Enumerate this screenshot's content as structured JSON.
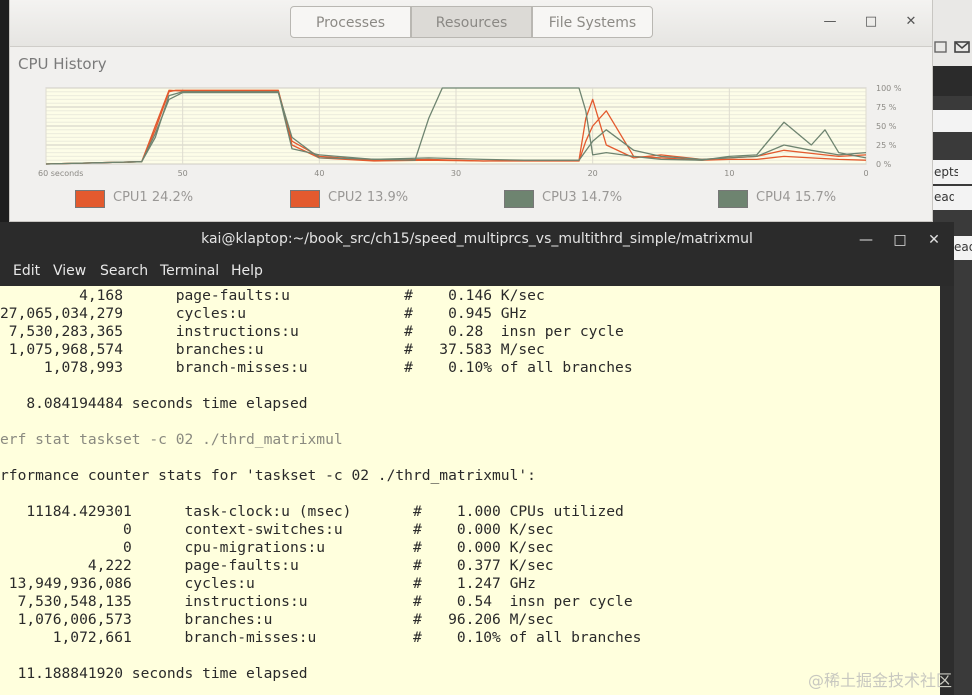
{
  "sysmon": {
    "tabs": [
      "Processes",
      "Resources",
      "File Systems"
    ],
    "active_tab": 1,
    "controls": {
      "minimize": "—",
      "maximize": "□",
      "close": "✕"
    },
    "cpu_history_title": "CPU History",
    "legend": [
      {
        "label": "CPU1  24.2%",
        "color": "#e35a2e"
      },
      {
        "label": "CPU2  13.9%",
        "color": "#e35a2e"
      },
      {
        "label": "CPU3  14.7%",
        "color": "#6e8470"
      },
      {
        "label": "CPU4  15.7%",
        "color": "#6e8470"
      }
    ]
  },
  "background_app": {
    "snippets": [
      "epts",
      "ead",
      "ead"
    ]
  },
  "chart_data": {
    "type": "line",
    "x_tick_labels": [
      "60 seconds",
      "50",
      "40",
      "30",
      "20",
      "10",
      "0"
    ],
    "y_tick_labels": [
      "100 %",
      "75 %",
      "50 %",
      "25 %",
      "0 %"
    ],
    "xlim": [
      60,
      0
    ],
    "ylim": [
      0,
      100
    ],
    "grid": true,
    "series": [
      {
        "name": "CPU1",
        "color": "#e35a2e",
        "x": [
          60,
          53,
          52,
          51,
          50.5,
          45,
          43,
          42,
          40,
          36,
          32,
          28,
          25,
          21,
          20.5,
          20,
          19,
          17,
          15,
          12,
          10,
          8,
          6,
          4,
          2,
          0
        ],
        "y": [
          0,
          3,
          45,
          95,
          97,
          97,
          97,
          30,
          10,
          5,
          6,
          4,
          5,
          5,
          60,
          85,
          25,
          8,
          12,
          6,
          8,
          10,
          18,
          14,
          10,
          12
        ]
      },
      {
        "name": "CPU2",
        "color": "#e35a2e",
        "x": [
          60,
          53,
          52,
          51,
          50,
          45,
          43,
          42,
          40,
          36,
          32,
          28,
          25,
          21,
          20.5,
          20,
          19,
          17,
          15,
          12,
          10,
          8,
          6,
          4,
          2,
          0
        ],
        "y": [
          0,
          3,
          50,
          97,
          96,
          96,
          96,
          25,
          8,
          4,
          5,
          4,
          4,
          4,
          30,
          50,
          70,
          10,
          8,
          5,
          6,
          6,
          10,
          8,
          6,
          5
        ]
      },
      {
        "name": "CPU3",
        "color": "#6e8470",
        "x": [
          60,
          53,
          52,
          51,
          50,
          45,
          43,
          42,
          40,
          33,
          32,
          31,
          28,
          25,
          21,
          20.5,
          20,
          19,
          17,
          15,
          12,
          10,
          8,
          6,
          4,
          3,
          2,
          0
        ],
        "y": [
          0,
          3,
          40,
          85,
          94,
          94,
          94,
          35,
          8,
          5,
          60,
          100,
          100,
          100,
          100,
          70,
          12,
          15,
          10,
          6,
          5,
          10,
          12,
          55,
          25,
          45,
          15,
          8
        ]
      },
      {
        "name": "CPU4",
        "color": "#6e8470",
        "x": [
          60,
          53,
          52,
          51,
          50,
          45,
          43,
          42,
          40,
          36,
          32,
          28,
          25,
          21,
          20,
          19,
          17,
          15,
          12,
          10,
          8,
          6,
          4,
          2,
          0
        ],
        "y": [
          0,
          3,
          35,
          90,
          95,
          95,
          95,
          20,
          12,
          6,
          8,
          6,
          5,
          5,
          30,
          45,
          18,
          10,
          6,
          8,
          10,
          25,
          18,
          12,
          15
        ]
      }
    ]
  },
  "terminal": {
    "title": "kai@klaptop:~/book_src/ch15/speed_multiprcs_vs_multithrd_simple/matrixmul",
    "controls": {
      "minimize": "—",
      "maximize": "□",
      "close": "✕"
    },
    "menu": [
      "Edit",
      "View",
      "Search",
      "Terminal",
      "Help"
    ],
    "lines": [
      "         4,168      page-faults:u             #    0.146 K/sec",
      "27,065,034,279      cycles:u                  #    0.945 GHz",
      " 7,530,283,365      instructions:u            #    0.28  insn per cycle",
      " 1,075,968,574      branches:u                #   37.583 M/sec",
      "     1,078,993      branch-misses:u           #    0.10% of all branches",
      "",
      "   8.084194484 seconds time elapsed",
      "",
      "erf stat taskset -c 02 ./thrd_matrixmul",
      "",
      "rformance counter stats for 'taskset -c 02 ./thrd_matrixmul':",
      "",
      "   11184.429301      task-clock:u (msec)       #    1.000 CPUs utilized",
      "              0      context-switches:u        #    0.000 K/sec",
      "              0      cpu-migrations:u          #    0.000 K/sec",
      "          4,222      page-faults:u             #    0.377 K/sec",
      " 13,949,936,086      cycles:u                  #    1.247 GHz",
      "  7,530,548,135      instructions:u            #    0.54  insn per cycle",
      "  1,076,006,573      branches:u                #   96.206 M/sec",
      "      1,072,661      branch-misses:u           #    0.10% of all branches",
      "",
      "  11.188841920 seconds time elapsed"
    ]
  },
  "watermark": "@稀土掘金技术社区"
}
